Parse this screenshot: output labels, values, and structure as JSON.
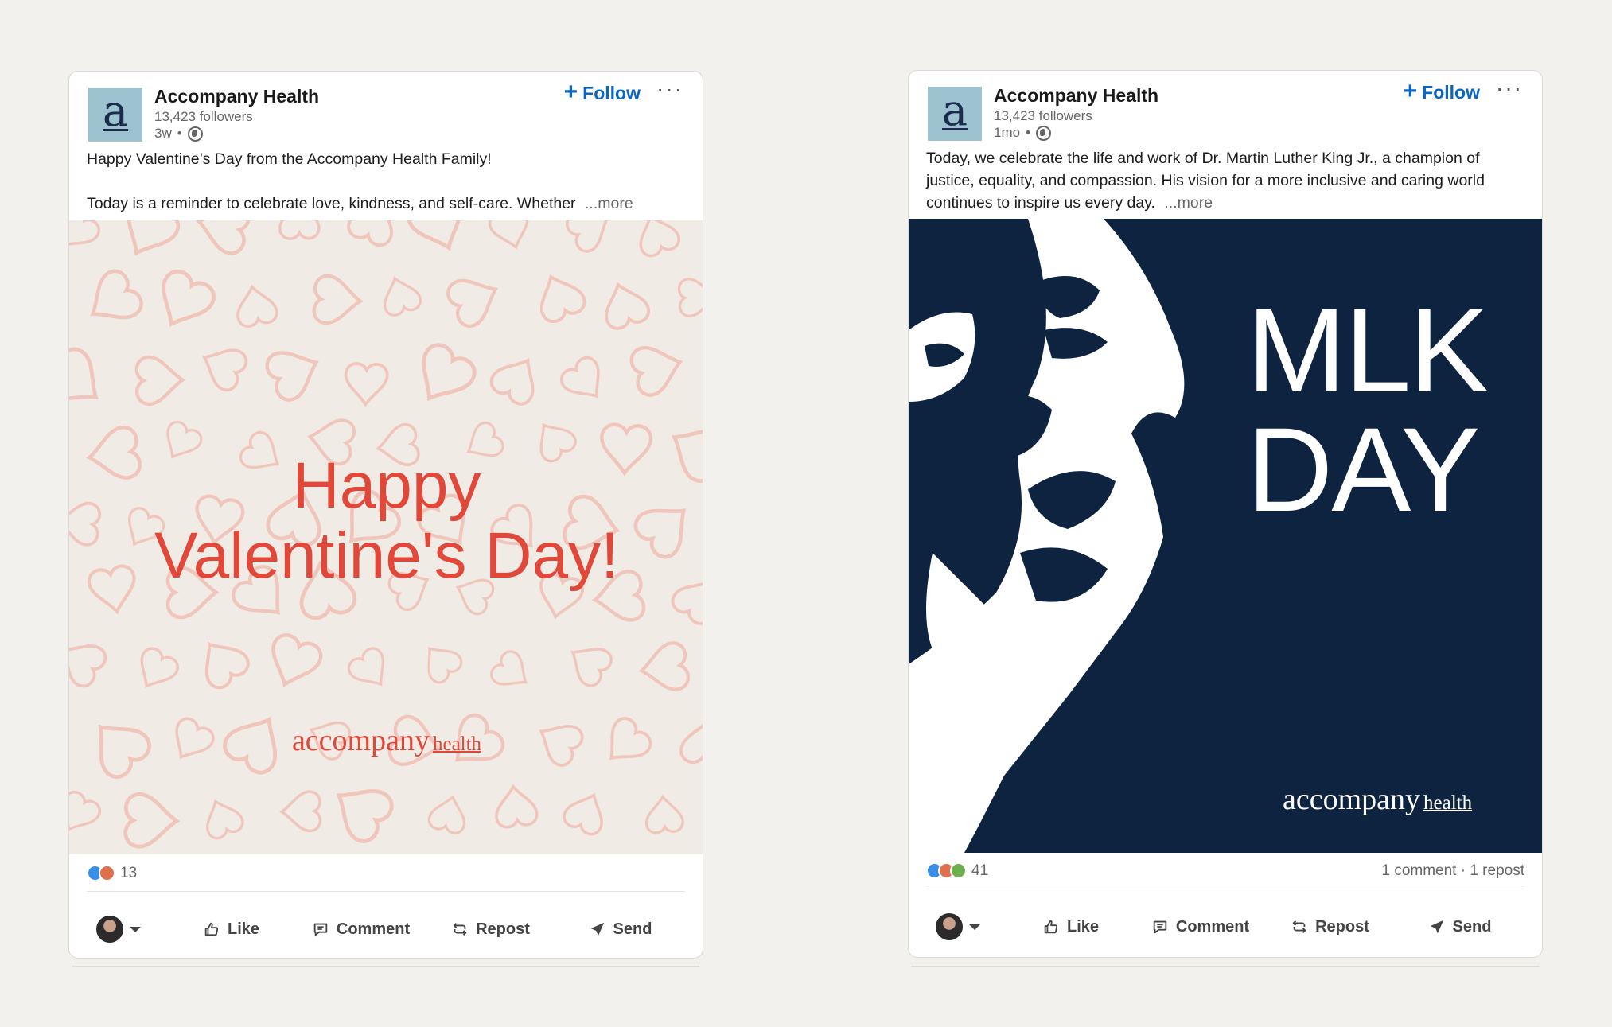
{
  "posts": [
    {
      "author": "Accompany Health",
      "followers": "13,423 followers",
      "time": "3w",
      "visibility_icon": "globe-icon",
      "logo_letter": "a",
      "follow_label": "Follow",
      "more_menu": "···",
      "text_line1": "Happy Valentine’s Day from the Accompany Health Family!",
      "text_line2": "Today is a reminder to celebrate love, kindness, and self-care. Whether",
      "see_more": "...more",
      "image": {
        "title_line1": "Happy",
        "title_line2": "Valentine's Day!",
        "brand_word1": "accompany",
        "brand_word2": "health",
        "background": "#f0ece5",
        "accent": "#e2483a"
      },
      "reaction_count": "13",
      "reaction_stats": "",
      "actions": {
        "like": "Like",
        "comment": "Comment",
        "repost": "Repost",
        "send": "Send"
      }
    },
    {
      "author": "Accompany Health",
      "followers": "13,423 followers",
      "time": "1mo",
      "visibility_icon": "globe-icon",
      "logo_letter": "a",
      "follow_label": "Follow",
      "more_menu": "···",
      "text_line1": "Today, we celebrate the life and work of Dr. Martin Luther King Jr., a champion of",
      "text_line2": "justice, equality, and compassion. His vision for a more inclusive and caring world",
      "text_line3": "continues to inspire us every day.",
      "see_more": "...more",
      "image": {
        "title_line1": "MLK",
        "title_line2": "DAY",
        "brand_word1": "accompany",
        "brand_word2": "health",
        "background": "#0e2340",
        "accent": "#ffffff"
      },
      "reaction_count": "41",
      "reaction_stats": "1 comment · 1 repost",
      "actions": {
        "like": "Like",
        "comment": "Comment",
        "repost": "Repost",
        "send": "Send"
      }
    }
  ],
  "colors": {
    "link_blue": "#0a66c2",
    "page_bg": "#f2f1ed",
    "logo_bg": "#9dc2d0",
    "logo_fg": "#1a2b4c"
  }
}
